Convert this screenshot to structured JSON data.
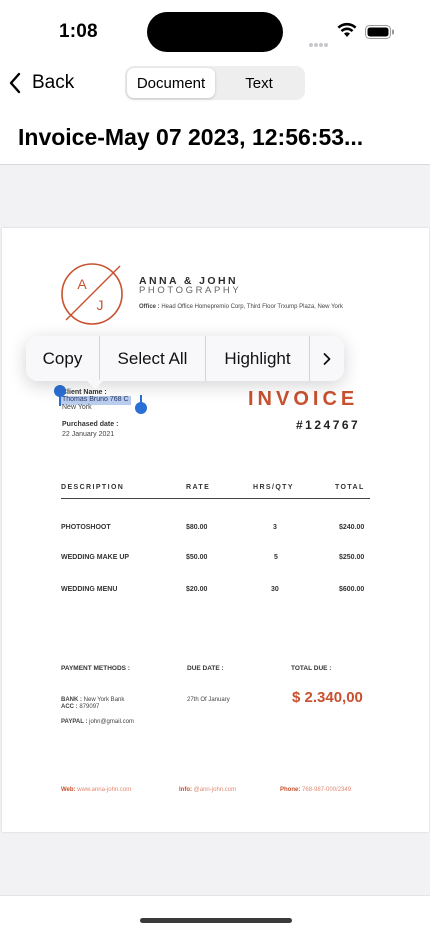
{
  "status_bar": {
    "time": "1:08"
  },
  "nav": {
    "back_label": "Back",
    "segments": [
      "Document",
      "Text"
    ],
    "selected_segment": "Document"
  },
  "title": "Invoice-May 07 2023, 12:56:53...",
  "context_menu": {
    "items": [
      "Copy",
      "Select All",
      "Highlight"
    ],
    "more_icon": "chevron-right-icon"
  },
  "document": {
    "logo_letters": [
      "A",
      "J"
    ],
    "brand_name": "ANNA & JOHN",
    "brand_sub": "PHOTOGRAPHY",
    "office_label": "Office :",
    "office_text": "Head Office Homepremio Corp, Third Floor Trxump Plaza, New York",
    "client_label": "Client Name :",
    "client_name": "Thomas Bruno 768 C",
    "client_city": "New York",
    "purchased_label": "Purchased date :",
    "purchased_date": "22 January 2021",
    "invoice_title": "INVOICE",
    "invoice_number": "#124767",
    "table": {
      "headers": [
        "DESCRIPTION",
        "RATE",
        "HRS/QTY",
        "TOTAL"
      ],
      "rows": [
        [
          "PHOTOSHOOT",
          "$80.00",
          "3",
          "$240.00"
        ],
        [
          "WEDDING MAKE UP",
          "$50.00",
          "5",
          "$250.00"
        ],
        [
          "WEDDING MENU",
          "$20.00",
          "30",
          "$600.00"
        ]
      ]
    },
    "payment_methods_label": "PAYMENT METHODS :",
    "bank_label": "BANK :",
    "bank_value": "New York Bank",
    "acc_label": "ACC :",
    "acc_value": "879097",
    "paypal_label": "PAYPAL :",
    "paypal_value": "john@gmail.com",
    "due_date_label": "DUE DATE :",
    "due_date_value": "27th Of January",
    "total_due_label": "TOTAL DUE :",
    "total_due_value": "$ 2.340,00",
    "contacts": {
      "web_label": "Web:",
      "web_value": "www.anna-john.com",
      "info_label": "Info:",
      "info_value": "@ann-john.com",
      "phone_label": "Phone:",
      "phone_value": "768-987-000/2349"
    }
  },
  "colors": {
    "accent": "#c8512f",
    "selection": "#2a6fd6",
    "selection_fill": "#b9cdef"
  }
}
